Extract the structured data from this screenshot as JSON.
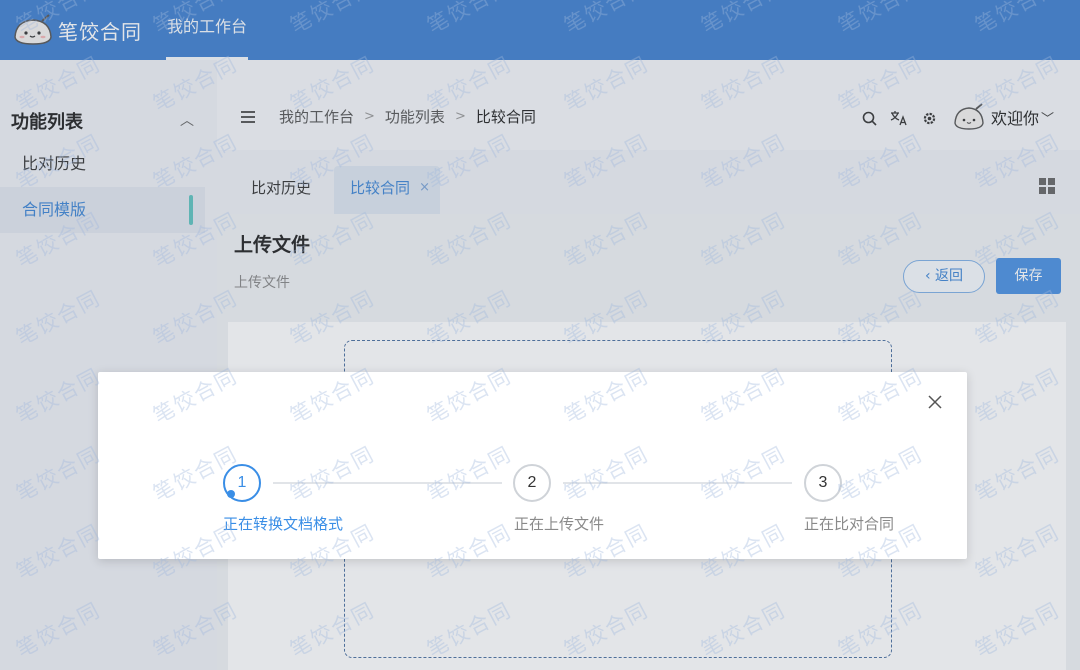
{
  "header": {
    "brand": "笔饺合同",
    "nav_item": "我的工作台"
  },
  "sidebar": {
    "title": "功能列表",
    "items": [
      {
        "label": "比对历史"
      },
      {
        "label": "合同模版"
      }
    ]
  },
  "topbar": {
    "breadcrumb": [
      "我的工作台",
      "功能列表",
      "比较合同"
    ],
    "breadcrumb_sep": ">",
    "welcome": "欢迎你"
  },
  "tabs": [
    {
      "label": "比对历史"
    },
    {
      "label": "比较合同",
      "close": "×"
    }
  ],
  "page": {
    "title": "上传文件",
    "subtitle": "上传文件",
    "back_button": "返回",
    "save_button": "保存"
  },
  "modal": {
    "steps": [
      {
        "number": "1",
        "label": "正在转换文档格式"
      },
      {
        "number": "2",
        "label": "正在上传文件"
      },
      {
        "number": "3",
        "label": "正在比对合同"
      }
    ]
  },
  "watermark": "笔饺合同",
  "colors": {
    "header": "#3f7fd0",
    "accent": "#3a8ee6",
    "sidebar_active_bar": "#5ec4c0"
  }
}
